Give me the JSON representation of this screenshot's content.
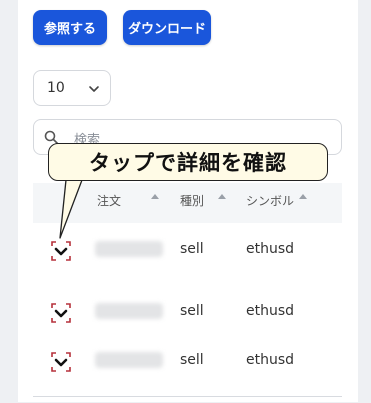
{
  "toolbar": {
    "reference_label": "参照する",
    "download_label": "ダウンロード"
  },
  "page_size": {
    "selected": "10"
  },
  "search": {
    "placeholder": "検索"
  },
  "table": {
    "columns": [
      "注文",
      "種別",
      "シンボル"
    ],
    "rows": [
      {
        "side": "sell",
        "symbol": "ethusd"
      },
      {
        "side": "sell",
        "symbol": "ethusd"
      },
      {
        "side": "sell",
        "symbol": "ethusd"
      }
    ]
  },
  "callout": {
    "text": "タップで詳細を確認"
  },
  "colors": {
    "primary": "#1a56db",
    "checkbox": "#b5313b"
  }
}
